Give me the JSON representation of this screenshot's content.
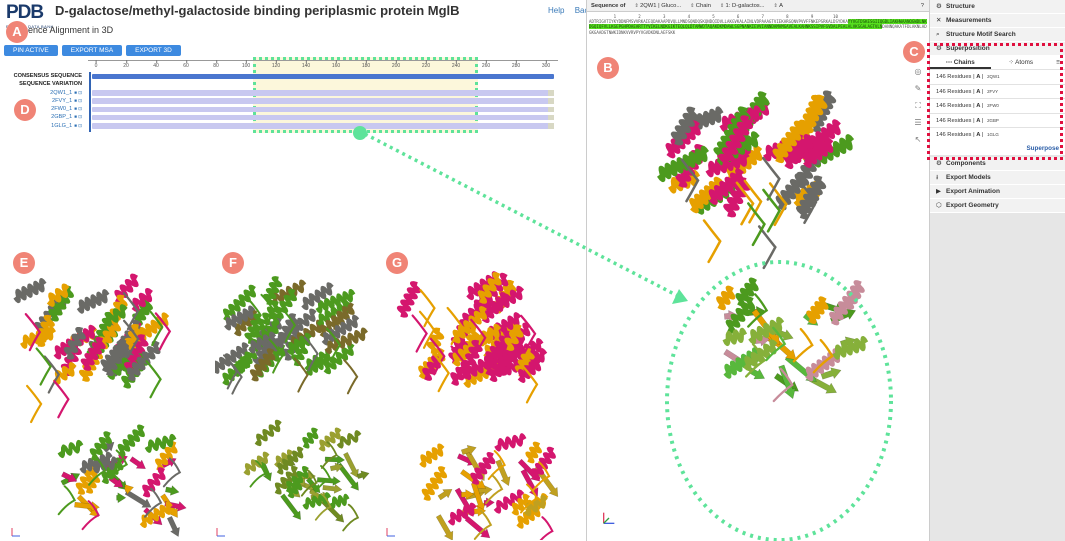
{
  "header": {
    "logo_text": "PDB",
    "logo_subtext": "PROTEIN DATA BANK",
    "title": "D-galactose/methyl-galactoside binding periplasmic protein MglB",
    "subtitle": "Sequence Alignment in 3D",
    "help_link": "Help",
    "back_link": "Back"
  },
  "buttons": {
    "pin": "PIN ACTIVE",
    "export_msa": "EXPORT MSA",
    "export_3d": "EXPORT 3D"
  },
  "msa": {
    "ruler_ticks": [
      "0",
      "20",
      "40",
      "60",
      "80",
      "100",
      "120",
      "140",
      "160",
      "180",
      "200",
      "220",
      "240",
      "260",
      "280",
      "300"
    ],
    "rows": [
      {
        "label": "CONSENSUS SEQUENCE",
        "kind": "consensus"
      },
      {
        "label": "SEQUENCE VARIATION",
        "kind": "variation"
      },
      {
        "label": "2QW1_1",
        "kind": "chain"
      },
      {
        "label": "2FVY_1",
        "kind": "chain"
      },
      {
        "label": "2FW0_1",
        "kind": "chain"
      },
      {
        "label": "2GBP_1",
        "kind": "chain"
      },
      {
        "label": "1GLG_1",
        "kind": "chain"
      }
    ]
  },
  "markers": {
    "a": "A",
    "b": "B",
    "c": "C",
    "d": "D",
    "e": "E",
    "f": "F",
    "g": "G"
  },
  "viewer": {
    "seq_label": "Sequence of",
    "entry_select": "2QW1 | Gluco...",
    "mode_select": "Chain",
    "chain_select": "1: D-galactos...",
    "asym_select": "A",
    "help_icon": "?",
    "seq_numbers": "          1         2         3         4         5         6         7         8         9        10",
    "seq_line1": "ADTRIGVTIYKYDDNFMSVVRKAIEQDAKAAPDVQLLMNDSQNDQSKQNDQIDVLLAKGVKALAINLVDPAAAGTVIEKARGQNVPVVFFNKEPSRKALDSYDKA",
    "seq_hl1": "YYVGTDSKESGIIQGDLIAKHWAANQGWDLNKDGQIQFVLLKGEPGHPDAEARTTYVIKELNDKGIKTEQLQLDTAMWDTAQAKDKMDAWLSGPNANKIEVVIAN",
    "seq_hl2": "NDAMAMGAVEALKAHNKSSIPVFGVDALPEALALVKSGALAGTVLN",
    "seq_tail": "DANNQAKATFDLAKNLADGKGAADGTNWKIDNKVVRVPYVGVDKDNLAEFSKK"
  },
  "panel": {
    "items_top": [
      {
        "icon": "⚙",
        "label": "Structure"
      },
      {
        "icon": "✕",
        "label": "Measurements"
      },
      {
        "icon": "⌕",
        "label": "Structure Motif Search"
      },
      {
        "icon": "⚙",
        "label": "Superposition"
      }
    ],
    "tabs": [
      {
        "icon": "⋯",
        "label": "Chains"
      },
      {
        "icon": "⁘",
        "label": "Atoms"
      }
    ],
    "tab_options_icon": "≡",
    "rows": [
      {
        "residues": "146 Residues",
        "chain": "A",
        "code": "2QW1"
      },
      {
        "residues": "146 Residues",
        "chain": "A",
        "code": "2FVY"
      },
      {
        "residues": "146 Residues",
        "chain": "A",
        "code": "2FW0"
      },
      {
        "residues": "146 Residues",
        "chain": "A",
        "code": "2GBP"
      },
      {
        "residues": "146 Residues",
        "chain": "A",
        "code": "1GLG"
      }
    ],
    "superpose": "Superpose",
    "items_bottom": [
      {
        "icon": "⚙",
        "label": "Components"
      },
      {
        "icon": "⭳",
        "label": "Export Models"
      },
      {
        "icon": "▶",
        "label": "Export Animation"
      },
      {
        "icon": "⬡",
        "label": "Export Geometry"
      }
    ]
  },
  "colors": {
    "accent_blue": "#3d8ae0",
    "marker": "#f08476",
    "highlight_green": "#5ee39a",
    "highlight_red": "#e0103f",
    "seq_highlight": "#56e01e",
    "ribbon_magenta": "#d4166e",
    "ribbon_orange": "#e6a000",
    "ribbon_green": "#4c9a1e",
    "ribbon_gray": "#6a6a66"
  }
}
